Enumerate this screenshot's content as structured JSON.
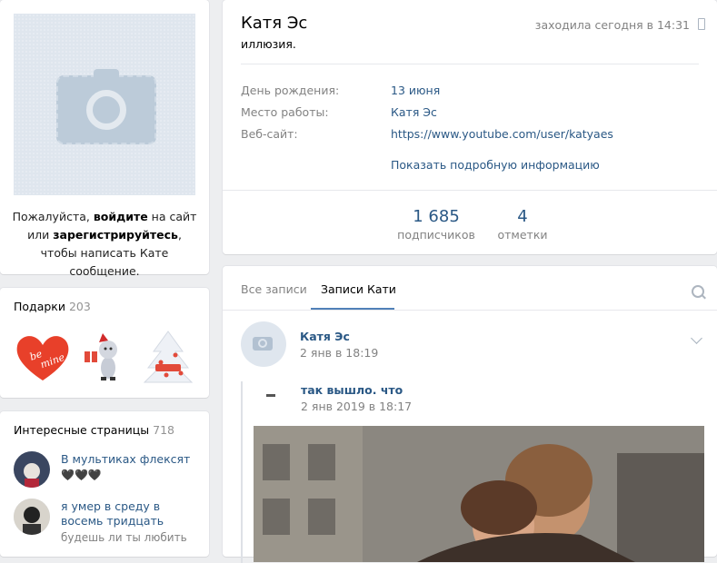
{
  "left": {
    "login": {
      "prefix": "Пожалуйста, ",
      "login_link": "войдите",
      "middle": " на сайт или ",
      "register_link": "зарегистрируйтесь",
      "suffix": ", чтобы написать Кате сообщение."
    },
    "gifts": {
      "title": "Подарки",
      "count": "203"
    },
    "pages": {
      "title": "Интересные страницы",
      "count": "718",
      "items": [
        {
          "name": "В мультиках флексят",
          "desc": "🖤🖤🖤"
        },
        {
          "name": "я умер в среду в восемь тридцать",
          "desc": "будешь ли ты любить"
        }
      ]
    }
  },
  "profile": {
    "name": "Катя Эс",
    "status": "иллюзия.",
    "last_seen": "заходила сегодня в 14:31",
    "info": [
      {
        "label": "День рождения:",
        "value": "13 июня"
      },
      {
        "label": "Место работы:",
        "value": "Катя Эс"
      },
      {
        "label": "Веб-сайт:",
        "value": "https://www.youtube.com/user/katyaes"
      }
    ],
    "more_info": "Показать подробную информацию",
    "counters": [
      {
        "number": "1 685",
        "label": "подписчиков"
      },
      {
        "number": "4",
        "label": "отметки"
      }
    ]
  },
  "wall": {
    "tabs": [
      "Все записи",
      "Записи Кати"
    ],
    "post": {
      "author": "Катя Эс",
      "date": "2 янв в 18:19",
      "repost_author": "так вышло. что",
      "repost_date": "2 янв 2019 в 18:17"
    }
  },
  "colors": {
    "link": "#2a5885",
    "accent": "#5181b8",
    "muted": "#828282"
  }
}
